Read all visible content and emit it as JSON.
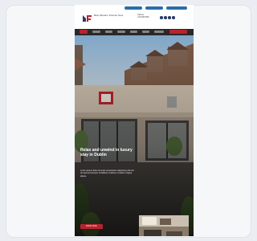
{
  "header": {
    "brand_name": "Best Western Premier Hotel",
    "contact_line1": "Call us",
    "contact_line2": "+00 000 000"
  },
  "hero": {
    "headline": "Relax and unwind in luxury stay in Dublin",
    "body": "Lorem ipsum dolor sit amet consectetur adipiscing elit sed do eiusmod tempor incididunt ut labore et dolore magna aliqua.",
    "cta_label": "BOOK NOW"
  },
  "colors": {
    "brand_red": "#b8232e",
    "nav_dark": "#2a2828",
    "topbar_pill": "#2c6ea6",
    "page_bg": "#eaeef2"
  },
  "icons": [
    "logo-icon",
    "facebook-icon",
    "twitter-icon",
    "instagram-icon",
    "youtube-icon"
  ]
}
